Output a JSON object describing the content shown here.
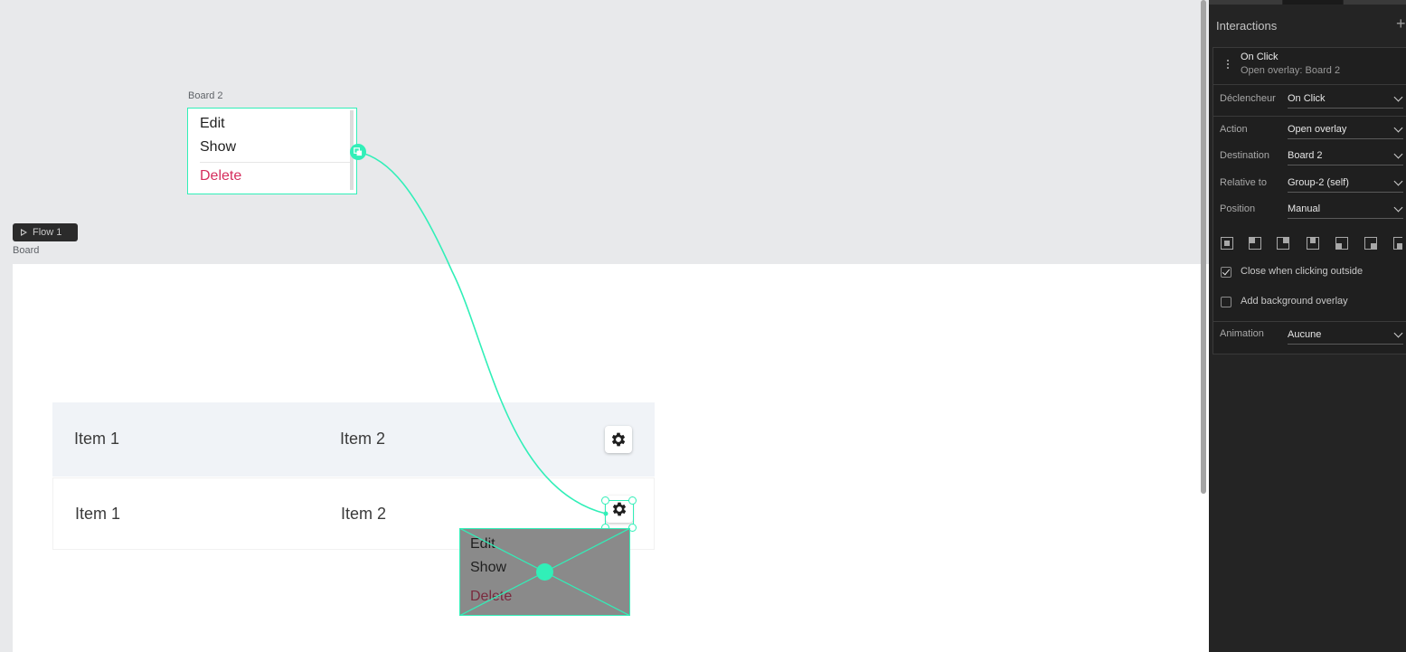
{
  "canvas": {
    "board2": {
      "label": "Board 2",
      "menu": {
        "edit": "Edit",
        "show": "Show",
        "delete": "Delete"
      }
    },
    "flow_label": "Flow 1",
    "board_label": "Board",
    "table": {
      "rows": [
        {
          "col1": "Item 1",
          "col2": "Item 2",
          "action_icon": "gear-icon"
        },
        {
          "col1": "Item 1",
          "col2": "Item 2",
          "action_icon": "gear-icon"
        }
      ]
    },
    "overlay_preview": {
      "menu": {
        "edit": "Edit",
        "show": "Show",
        "delete": "Delete"
      }
    }
  },
  "panel": {
    "title": "Interactions",
    "add_icon": "+",
    "interaction": {
      "trigger_title": "On Click",
      "summary": "Open overlay: Board 2"
    },
    "fields": {
      "trigger": {
        "label": "Déclencheur",
        "value": "On Click"
      },
      "action": {
        "label": "Action",
        "value": "Open overlay"
      },
      "destination": {
        "label": "Destination",
        "value": "Board 2"
      },
      "relative_to": {
        "label": "Relative to",
        "value": "Group-2 (self)"
      },
      "position": {
        "label": "Position",
        "value": "Manual"
      },
      "animation": {
        "label": "Animation",
        "value": "Aucune"
      }
    },
    "checkboxes": {
      "close_outside": {
        "label": "Close when clicking outside",
        "checked": true
      },
      "bg_overlay": {
        "label": "Add background overlay",
        "checked": false
      }
    }
  },
  "colors": {
    "accent": "#31efb8",
    "danger": "#d52d5d",
    "panel_bg": "#242424",
    "canvas_bg": "#e8e9eb"
  }
}
